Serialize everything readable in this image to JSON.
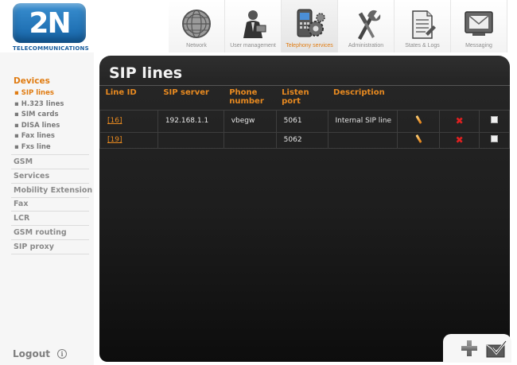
{
  "logo": {
    "brand": "2N",
    "tagline": "TELECOMMUNICATIONS"
  },
  "topnav": [
    {
      "label": "Network",
      "icon": "network-globe-icon"
    },
    {
      "label": "User management",
      "icon": "user-management-icon"
    },
    {
      "label": "Telephony services",
      "icon": "telephony-services-icon"
    },
    {
      "label": "Administration",
      "icon": "administration-tools-icon"
    },
    {
      "label": "States & Logs",
      "icon": "states-logs-icon"
    },
    {
      "label": "Messaging",
      "icon": "messaging-icon"
    }
  ],
  "active_nav": "Telephony services",
  "sidebar": {
    "section": "Devices",
    "subitems": [
      "SIP lines",
      "H.323 lines",
      "SIM cards",
      "DISA lines",
      "Fax lines",
      "Fxs line"
    ],
    "active_subitem": "SIP lines",
    "items": [
      "GSM",
      "Services",
      "Mobility Extension",
      "Fax",
      "LCR",
      "GSM routing",
      "SIP proxy"
    ],
    "logout": "Logout"
  },
  "main": {
    "title": "SIP lines",
    "columns": [
      "Line ID",
      "SIP server",
      "Phone number",
      "Listen port",
      "Description"
    ],
    "rows": [
      {
        "id": "[16]",
        "server": "192.168.1.1",
        "phone": "vbegw",
        "port": "5061",
        "description": "Internal SIP line"
      },
      {
        "id": "[19]",
        "server": "",
        "phone": "",
        "port": "5062",
        "description": ""
      }
    ]
  },
  "colors": {
    "accent": "#e07c12",
    "panel": "#1d1d1d",
    "delete": "#e02020"
  }
}
